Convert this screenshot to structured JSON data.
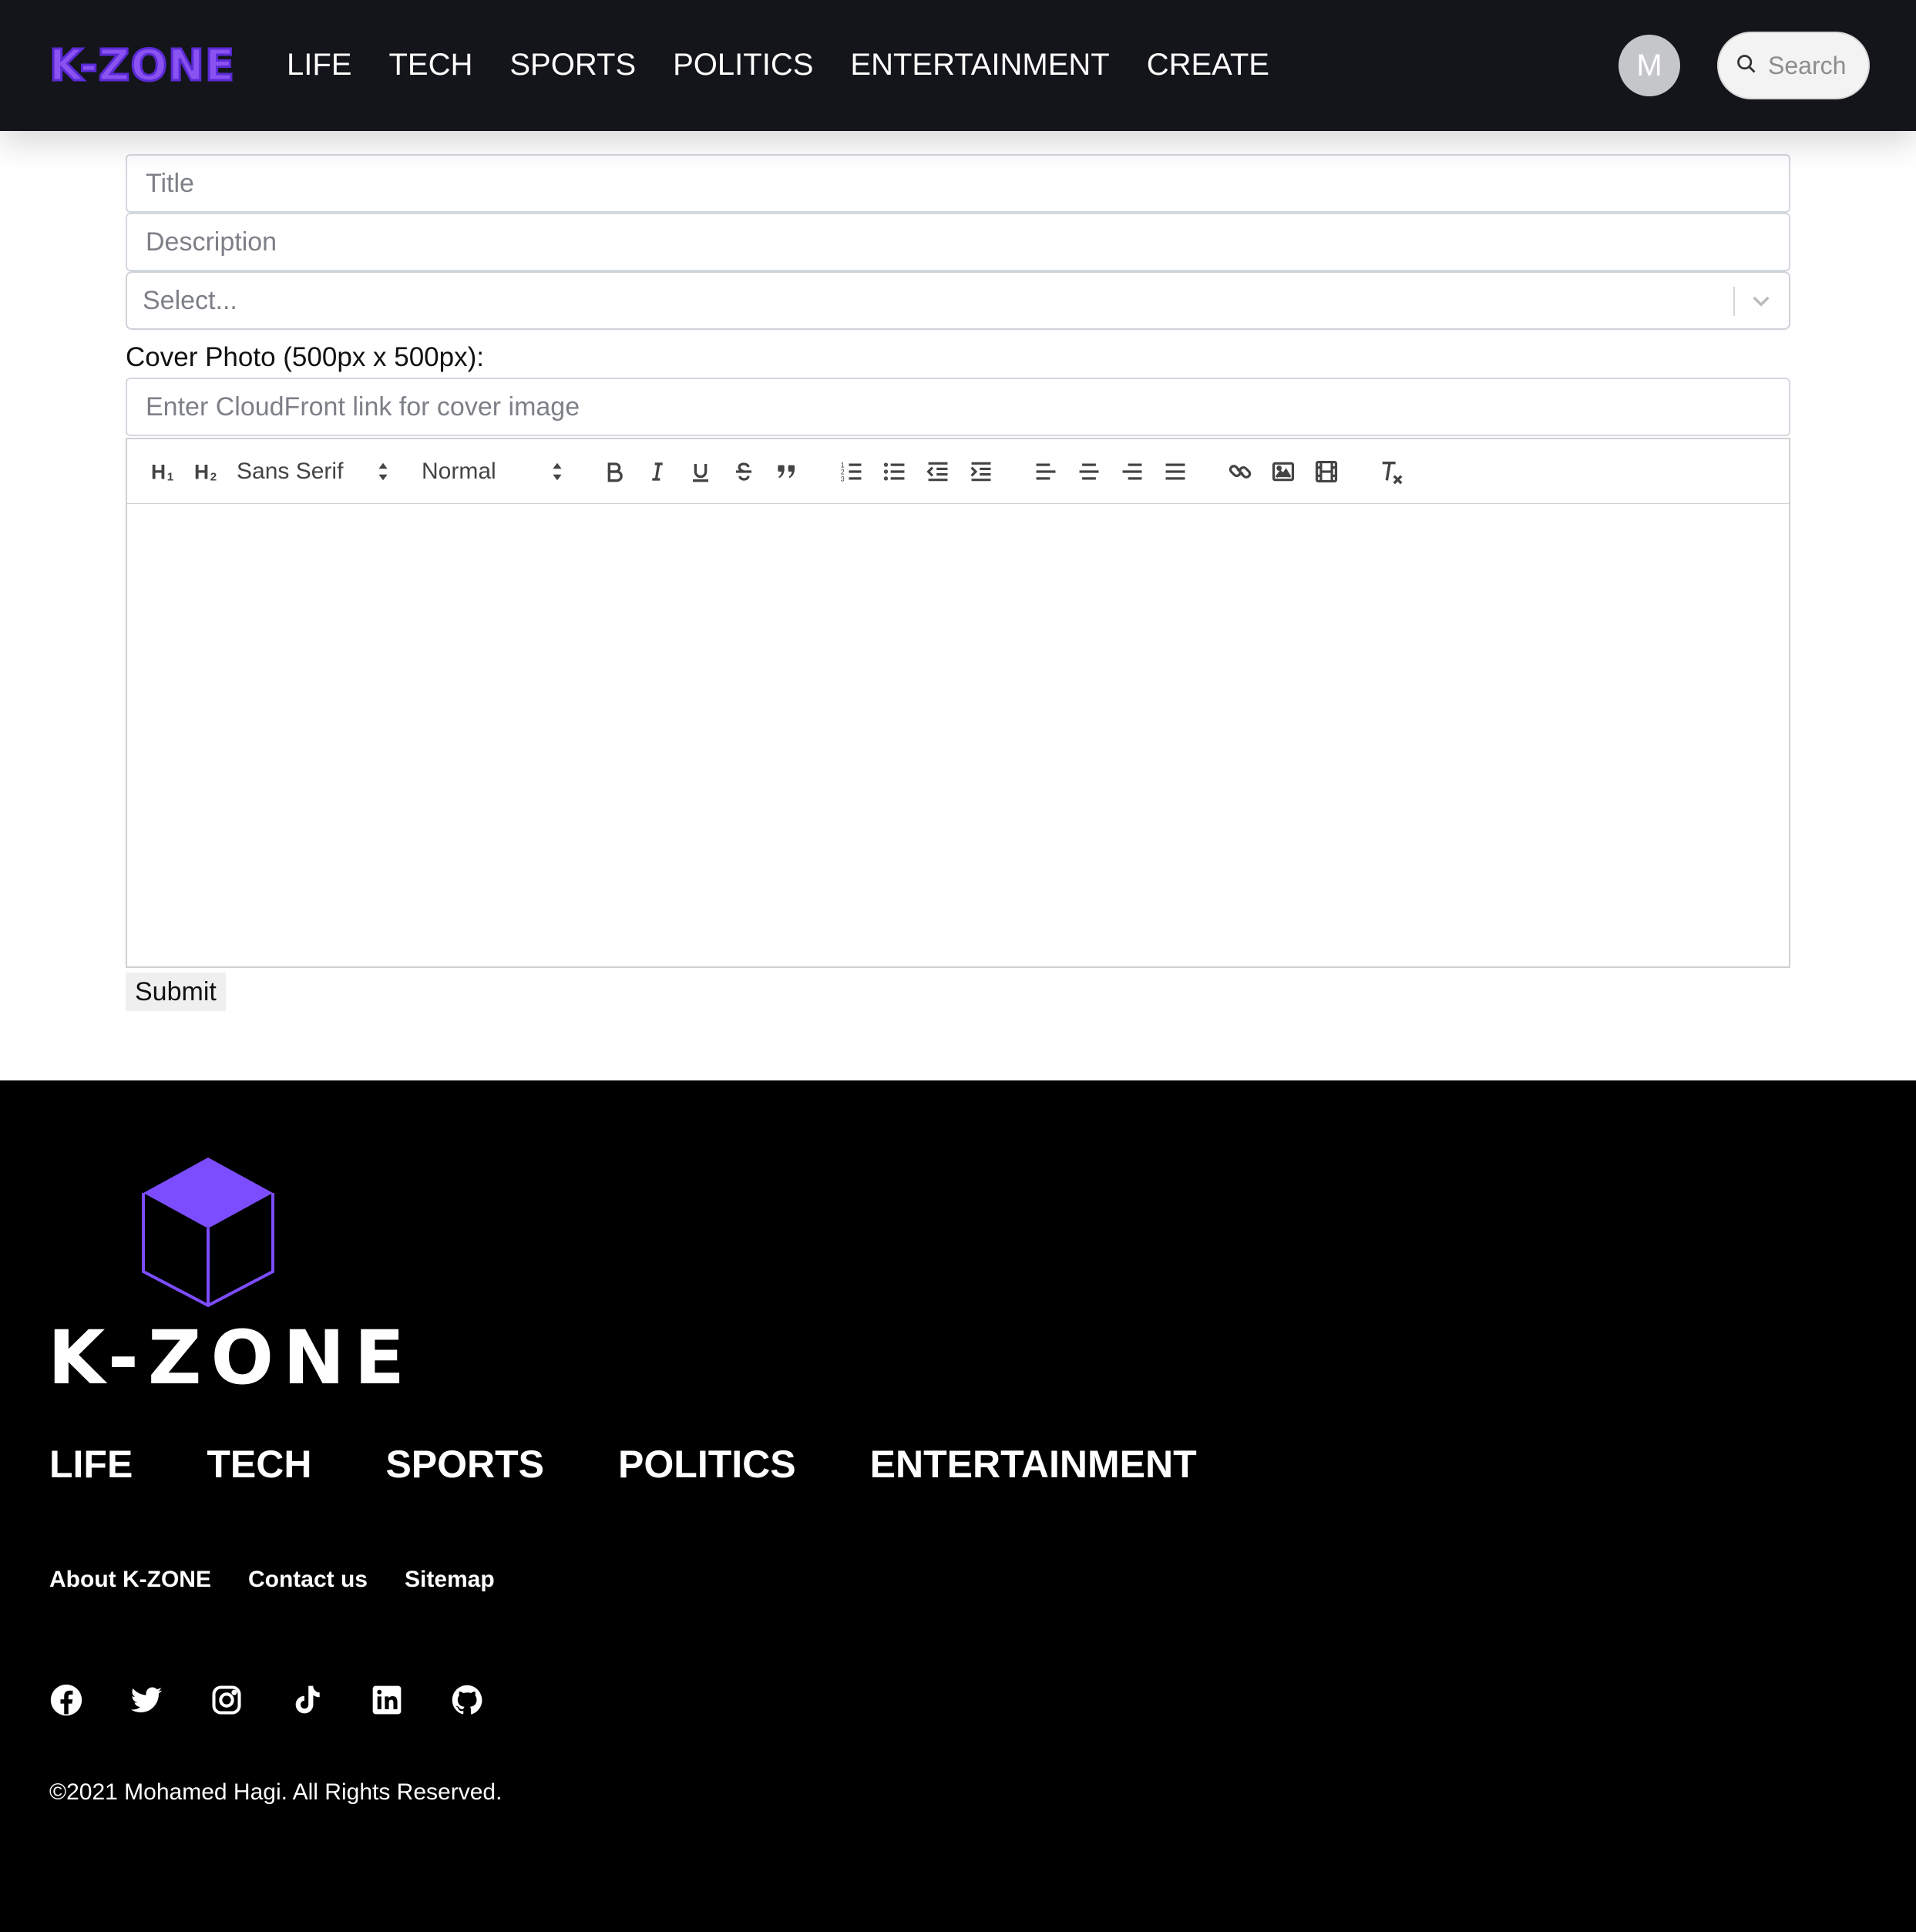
{
  "header": {
    "logo": "K-ZONE",
    "nav": [
      "LIFE",
      "TECH",
      "SPORTS",
      "POLITICS",
      "ENTERTAINMENT",
      "CREATE"
    ],
    "avatar_initial": "M",
    "search_placeholder": "Search"
  },
  "form": {
    "title_placeholder": "Title",
    "description_placeholder": "Description",
    "select_placeholder": "Select...",
    "cover_label": "Cover Photo (500px x 500px):",
    "cover_placeholder": "Enter CloudFront link for cover image",
    "toolbar": {
      "h1": "H1",
      "h2": "H2",
      "font": "Sans Serif",
      "size": "Normal",
      "icons": [
        "bold-icon",
        "italic-icon",
        "underline-icon",
        "strikethrough-icon",
        "blockquote-icon",
        "ordered-list-icon",
        "bullet-list-icon",
        "outdent-icon",
        "indent-icon",
        "align-left-icon",
        "align-center-icon",
        "align-right-icon",
        "align-justify-icon",
        "link-icon",
        "image-icon",
        "video-icon",
        "clear-format-icon"
      ]
    },
    "submit_label": "Submit"
  },
  "footer": {
    "logo": "K-ZONE",
    "nav": [
      "LIFE",
      "TECH",
      "SPORTS",
      "POLITICS",
      "ENTERTAINMENT"
    ],
    "links": [
      "About K-ZONE",
      "Contact us",
      "Sitemap"
    ],
    "socials": [
      "facebook-icon",
      "twitter-icon",
      "instagram-icon",
      "tiktok-icon",
      "linkedin-icon",
      "github-icon"
    ],
    "copyright": "©2021 Mohamed Hagi. All Rights Reserved."
  },
  "colors": {
    "header_bg": "#14151b",
    "brand_purple": "#7c4dff",
    "footer_bg": "#000000"
  }
}
